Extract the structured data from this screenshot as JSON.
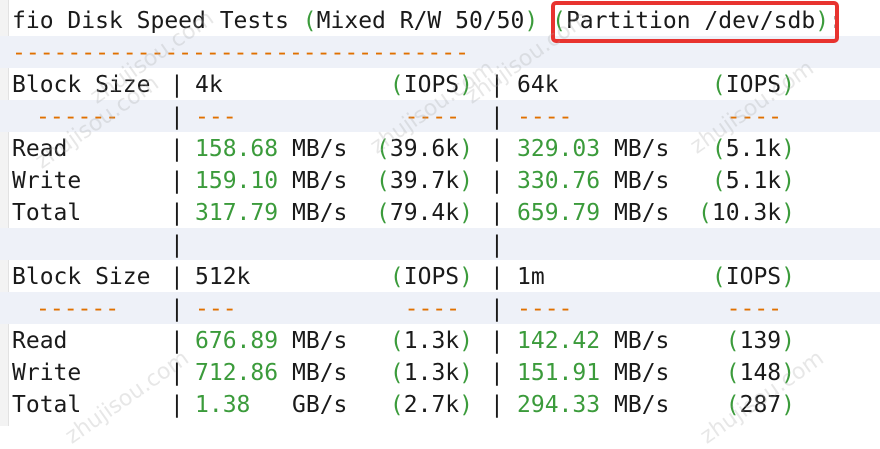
{
  "header": {
    "title": "fio Disk Speed Tests ",
    "paren_open": "(",
    "mode": "Mixed R/W 50/50",
    "paren_close": ")",
    "space": " ",
    "partition_open": "(",
    "partition": "Partition /dev/sdb",
    "partition_close": ")",
    "colon": ":"
  },
  "separator": "---------------------------------",
  "blocks": [
    {
      "left": {
        "size": "4k",
        "iops_label": "IOPS"
      },
      "right": {
        "size": "64k",
        "iops_label": "IOPS"
      },
      "rows": [
        {
          "label": "Read",
          "l_val": "158.68",
          "l_unit": "MB/s",
          "l_iops": "39.6k",
          "r_val": "329.03",
          "r_unit": "MB/s",
          "r_iops": "5.1k"
        },
        {
          "label": "Write",
          "l_val": "159.10",
          "l_unit": "MB/s",
          "l_iops": "39.7k",
          "r_val": "330.76",
          "r_unit": "MB/s",
          "r_iops": "5.1k"
        },
        {
          "label": "Total",
          "l_val": "317.79",
          "l_unit": "MB/s",
          "l_iops": "79.4k",
          "r_val": "659.79",
          "r_unit": "MB/s",
          "r_iops": "10.3k"
        }
      ]
    },
    {
      "left": {
        "size": "512k",
        "iops_label": "IOPS"
      },
      "right": {
        "size": "1m",
        "iops_label": "IOPS"
      },
      "rows": [
        {
          "label": "Read",
          "l_val": "676.89",
          "l_unit": "MB/s",
          "l_iops": "1.3k",
          "r_val": "142.42",
          "r_unit": "MB/s",
          "r_iops": "139"
        },
        {
          "label": "Write",
          "l_val": "712.86",
          "l_unit": "MB/s",
          "l_iops": "1.3k",
          "r_val": "151.91",
          "r_unit": "MB/s",
          "r_iops": "148"
        },
        {
          "label": "Total",
          "l_val": "1.38",
          "l_unit": "GB/s",
          "l_iops": "2.7k",
          "r_val": "294.33",
          "r_unit": "MB/s",
          "r_iops": "287"
        }
      ]
    }
  ],
  "labels": {
    "block_size": "Block Size",
    "dashes_label": "------",
    "dashes_short": "---",
    "dashes_mid": "----",
    "pipe": "|"
  },
  "watermark": "zhujisou.com",
  "colors": {
    "green": "#3b9b3b",
    "orange": "#e07000",
    "highlight": "#e8332f",
    "stripe": "#eef1f8"
  }
}
